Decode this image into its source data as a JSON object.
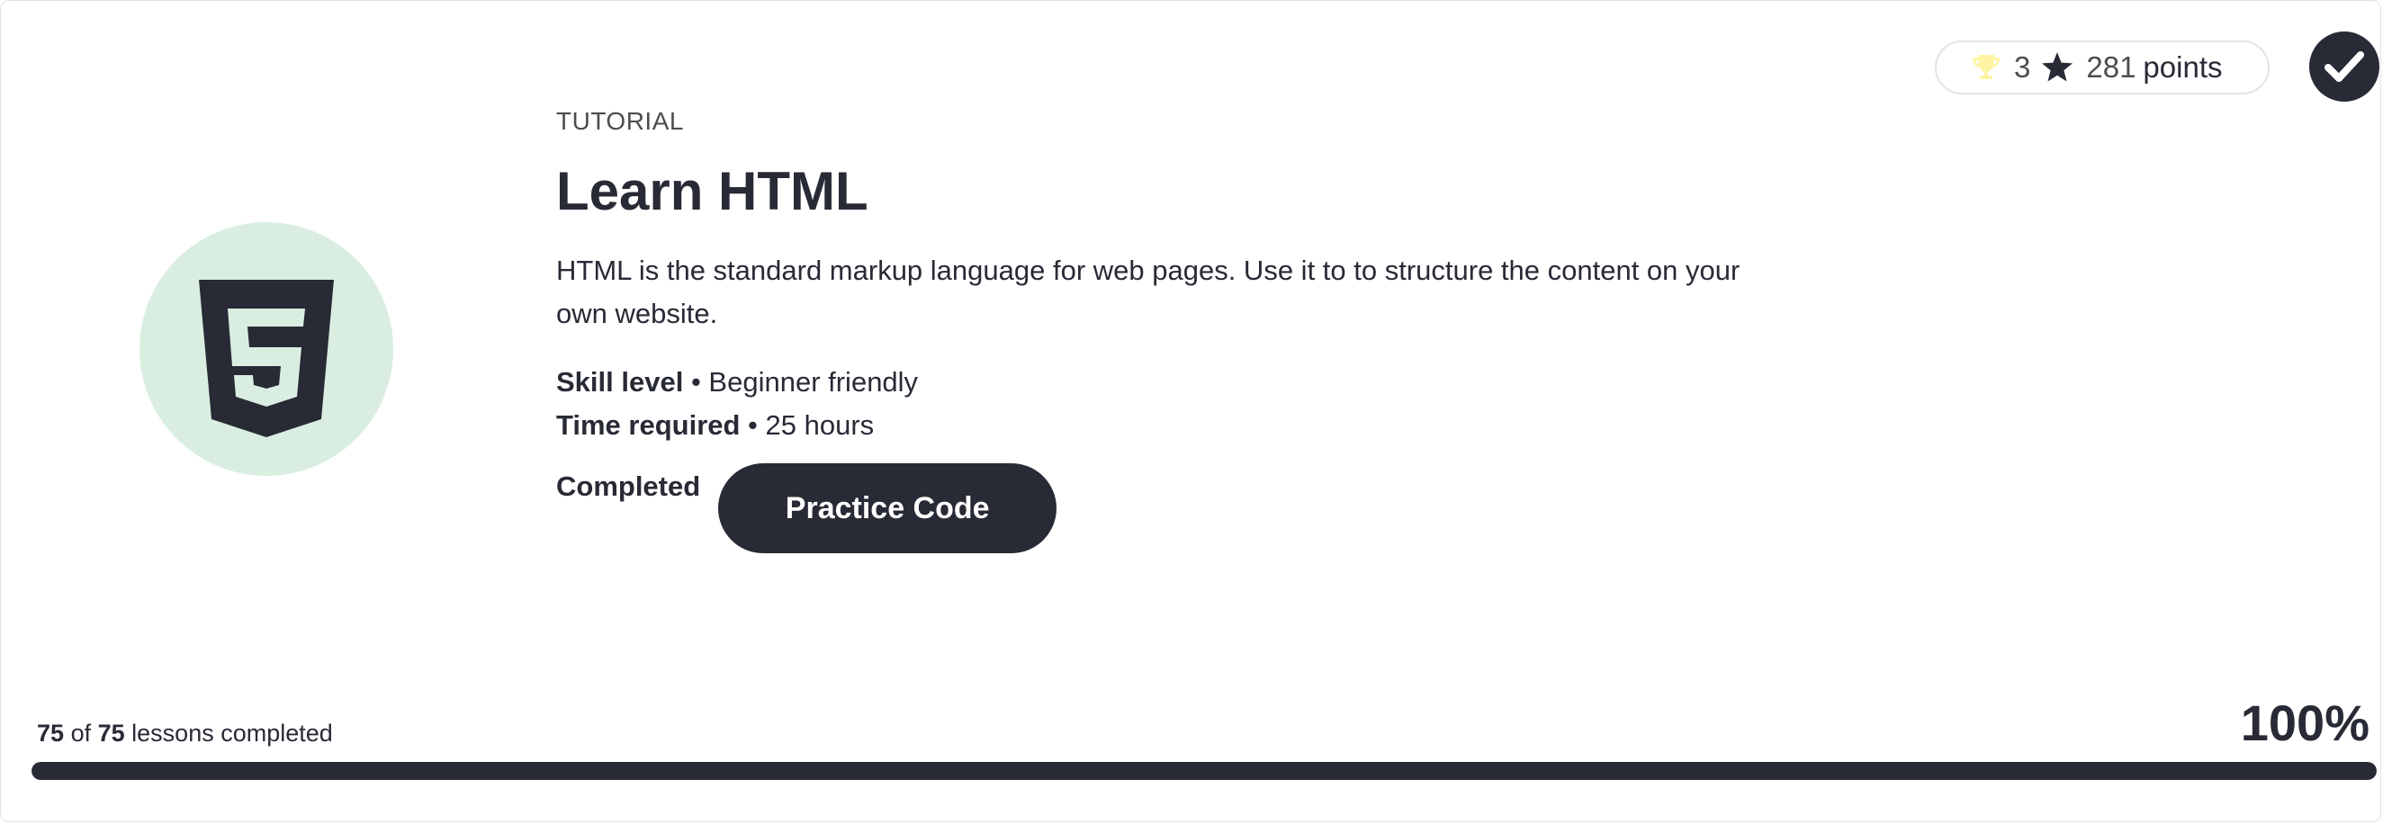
{
  "card": {
    "eyebrow": "TUTORIAL",
    "title": "Learn HTML",
    "description": "HTML is the standard markup language for web pages. Use it to to structure the content on your own website.",
    "skill_label": "Skill level",
    "skill_value": "Beginner friendly",
    "time_label": "Time required",
    "time_value": "25 hours",
    "separator": " • ",
    "status": "Completed",
    "button_label": "Practice Code",
    "logo_icon": "html5-icon"
  },
  "points": {
    "trophies": "3",
    "points": "281",
    "points_label": "points",
    "trophy_icon": "trophy-icon",
    "star_icon": "star-icon"
  },
  "completion": {
    "icon": "check-icon"
  },
  "progress": {
    "completed": "75",
    "of_word": "of",
    "total": "75",
    "suffix": "lessons completed",
    "percent_label": "100%",
    "fraction": 1.0
  },
  "colors": {
    "dark": "#282a35",
    "logo_bg": "#d9eee1",
    "trophy": "#fff4a3",
    "track": "#e6e6e6"
  }
}
